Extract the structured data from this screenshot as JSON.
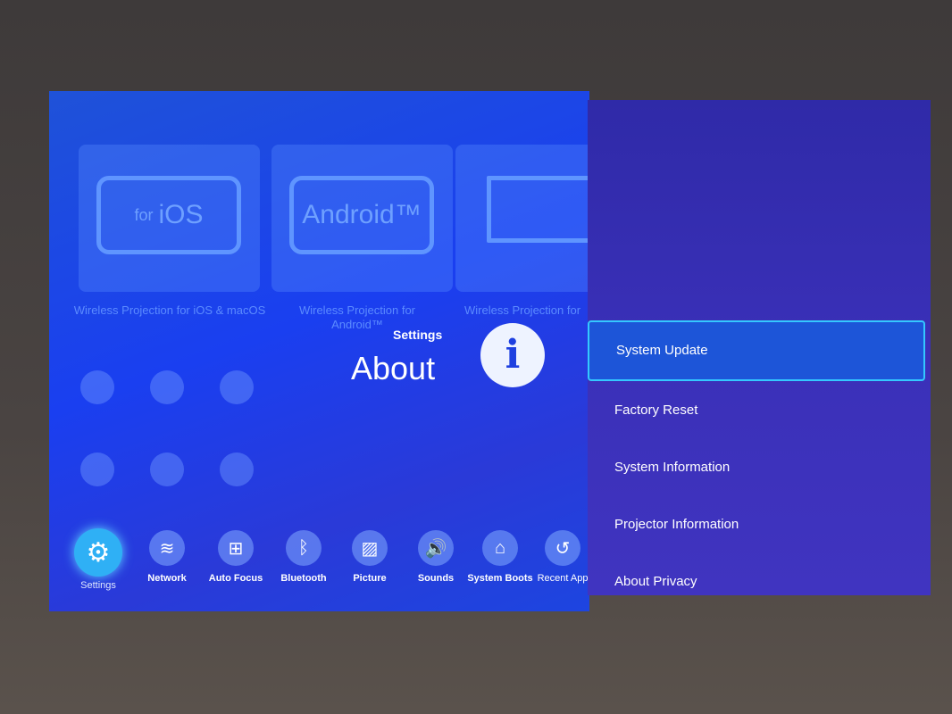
{
  "tiles": [
    {
      "device_text_prefix": "for",
      "device_text": "iOS",
      "label": "Wireless Projection for iOS & macOS"
    },
    {
      "device_text_prefix": "",
      "device_text": "Android™",
      "label": "Wireless Projection for Android™"
    },
    {
      "device_text_prefix": "",
      "device_text": "",
      "label": "Wireless Projection for"
    }
  ],
  "apps": [
    "pen-app-icon",
    "cloud-app-icon",
    "cast-app-icon",
    "mail-app-icon",
    "netflix-app-icon",
    "youtube-app-icon"
  ],
  "dock": [
    {
      "label": "Settings",
      "icon": "⚙",
      "selected": true
    },
    {
      "label": "Network",
      "icon": "≋"
    },
    {
      "label": "Auto Focus",
      "icon": "⊞"
    },
    {
      "label": "Bluetooth",
      "icon": "ᛒ"
    },
    {
      "label": "Picture",
      "icon": "▨"
    },
    {
      "label": "Sounds",
      "icon": "🔊"
    },
    {
      "label": "System Boots",
      "icon": "⌂"
    },
    {
      "label": "Recent App",
      "icon": "↺"
    }
  ],
  "about": {
    "section": "Settings",
    "title": "About",
    "icon_glyph": "i"
  },
  "menu": [
    {
      "label": "System Update",
      "selected": true
    },
    {
      "label": "Factory Reset"
    },
    {
      "label": "System Information"
    },
    {
      "label": "Projector Information"
    },
    {
      "label": "About Privacy"
    }
  ],
  "colors": {
    "screen": "#1a3ff0",
    "panel": "#3a30b8",
    "focus": "#34c8ff",
    "selected_dock": "#2fb0f5"
  }
}
